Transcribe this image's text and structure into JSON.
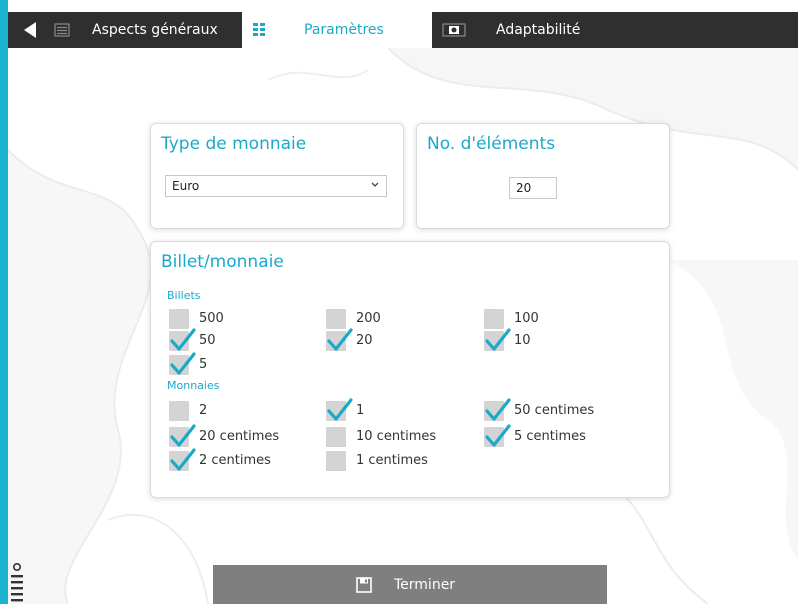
{
  "tabs": {
    "items": [
      {
        "label": "Aspects généraux"
      },
      {
        "label": "Paramètres"
      },
      {
        "label": "Adaptabilité"
      }
    ]
  },
  "currency": {
    "title": "Type de monnaie",
    "selected": "Euro"
  },
  "elements": {
    "title": "No. d'éléments",
    "value": "20"
  },
  "money": {
    "title": "Billet/monnaie",
    "billets_label": "Billets",
    "billets": [
      {
        "label": "500",
        "checked": false
      },
      {
        "label": "200",
        "checked": false
      },
      {
        "label": "100",
        "checked": false
      },
      {
        "label": "50",
        "checked": true
      },
      {
        "label": "20",
        "checked": true
      },
      {
        "label": "10",
        "checked": true
      },
      {
        "label": "5",
        "checked": true
      }
    ],
    "monnaies_label": "Monnaies",
    "monnaies": [
      {
        "label": "2",
        "checked": false
      },
      {
        "label": "1",
        "checked": true
      },
      {
        "label": "50 centimes",
        "checked": true
      },
      {
        "label": "20 centimes",
        "checked": true
      },
      {
        "label": "10 centimes",
        "checked": false
      },
      {
        "label": "5 centimes",
        "checked": true
      },
      {
        "label": "2 centimes",
        "checked": true
      },
      {
        "label": "1 centimes",
        "checked": false
      }
    ]
  },
  "finish": {
    "label": "Terminer"
  },
  "colors": {
    "accent": "#1ba8c9",
    "tabbar": "#2f2f2f",
    "frame": "#19b2cf",
    "checkbox": "#d4d4d4",
    "button": "#7f7f7f"
  }
}
